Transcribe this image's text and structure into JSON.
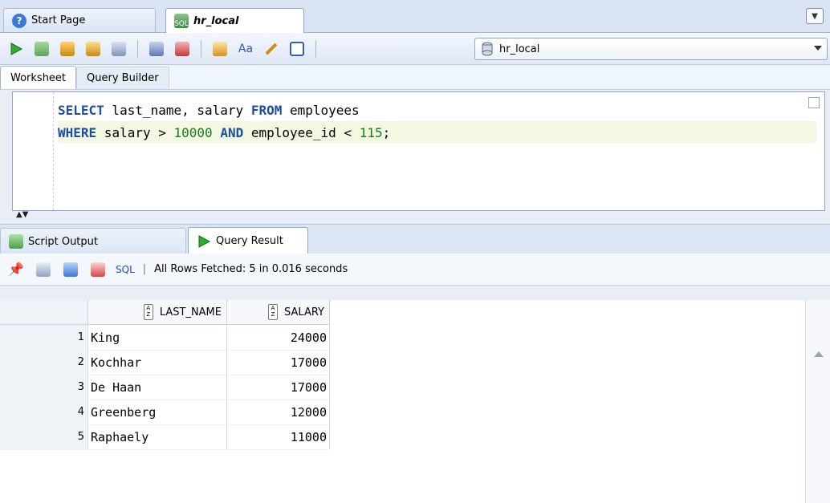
{
  "doc_tabs": [
    {
      "label": "Start Page"
    },
    {
      "label": "hr_local"
    }
  ],
  "toolbar": {
    "connection": "hr_local",
    "icons": [
      "run-statement-icon",
      "run-script-icon",
      "commit-icon",
      "rollback-icon",
      "autotrace-icon",
      "explain-plan-icon",
      "unshared-sql-icon",
      "sql-tuning-icon",
      "format-icon",
      "clear-icon",
      "history-icon",
      "connection-db-icon"
    ]
  },
  "worksheet_tabs": [
    {
      "label": "Worksheet"
    },
    {
      "label": "Query Builder"
    }
  ],
  "editor": {
    "line1": {
      "kw1": "SELECT",
      "mid": " last_name, salary ",
      "kw2": "FROM",
      "rest": " employees"
    },
    "line2": {
      "kw1": "WHERE",
      "mid": " salary > ",
      "num1": "10000",
      "sp": " ",
      "kw2": "AND",
      "mid2": " employee_id < ",
      "num2": "115",
      "tail": ";"
    }
  },
  "result_tabs": [
    {
      "label": "Script Output"
    },
    {
      "label": "Query Result"
    }
  ],
  "result_toolbar": {
    "sql_link": "SQL",
    "separator": "|",
    "status": "All Rows Fetched: 5 in 0.016 seconds"
  },
  "grid": {
    "columns": [
      "LAST_NAME",
      "SALARY"
    ],
    "rows": [
      {
        "num": "1",
        "last_name": "King",
        "salary": "24000"
      },
      {
        "num": "2",
        "last_name": "Kochhar",
        "salary": "17000"
      },
      {
        "num": "3",
        "last_name": "De Haan",
        "salary": "17000"
      },
      {
        "num": "4",
        "last_name": "Greenberg",
        "salary": "12000"
      },
      {
        "num": "5",
        "last_name": "Raphaely",
        "salary": "11000"
      }
    ]
  }
}
